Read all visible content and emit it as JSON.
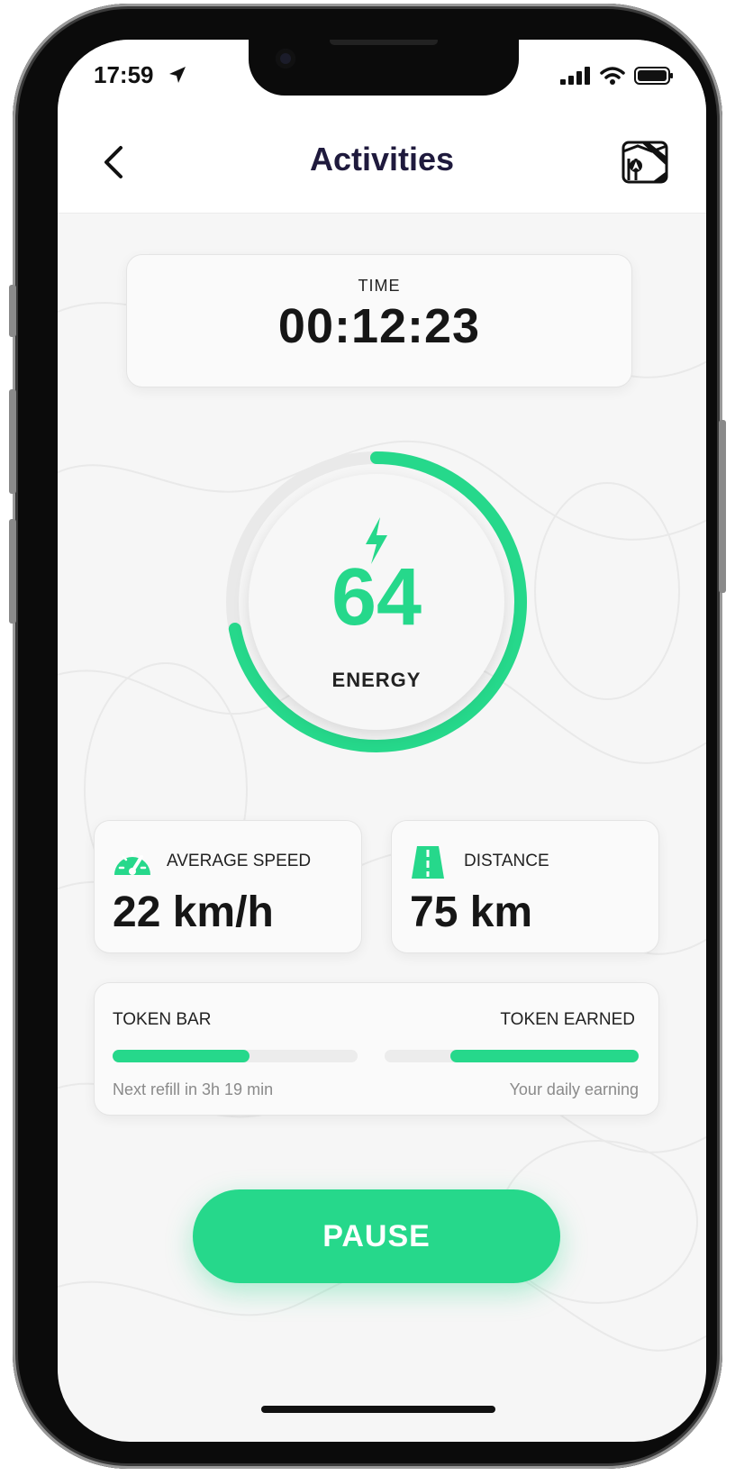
{
  "status_bar": {
    "time": "17:59"
  },
  "header": {
    "title": "Activities"
  },
  "time_card": {
    "label": "TIME",
    "value": "00:12:23"
  },
  "energy": {
    "value": "64",
    "label": "ENERGY",
    "progress_percent": 72
  },
  "stats": {
    "speed": {
      "label": "AVERAGE SPEED",
      "value": "22 km/h"
    },
    "distance": {
      "label": "DISTANCE",
      "value": "75 km"
    }
  },
  "tokens": {
    "bar_label": "TOKEN BAR",
    "bar_fill_percent": 56,
    "bar_note": "Next refill in 3h 19 min",
    "earned_label": "TOKEN EARNED",
    "earned_fill_percent": 74,
    "earned_note": "Your daily earning"
  },
  "actions": {
    "pause_label": "PAUSE"
  },
  "colors": {
    "accent": "#26d88b",
    "title": "#1f1a3d",
    "text": "#161616"
  }
}
